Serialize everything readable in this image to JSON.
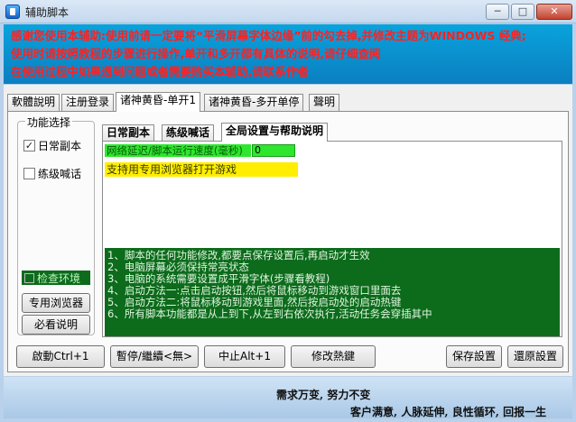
{
  "window": {
    "title": "辅助脚本",
    "min_label": "─",
    "max_label": "□",
    "close_label": "✕"
  },
  "banner": {
    "lines": [
      "感谢您使用本辅助:使用前请一定要将“平滑屏幕字体边缘”前的勾去掉,并修改主题为WINDOWS 经典;",
      "使用时请按照教程的步骤进行操作,单开和多开都有具体的说明,请仔细查阅",
      "在使用过程中如果遇到问题或者需要购买本辅助,请联系作者"
    ],
    "text_color": "#ff2020"
  },
  "tabs": [
    {
      "label": "軟體說明"
    },
    {
      "label": "注册登录"
    },
    {
      "label": "诸神黄昏-单开1"
    },
    {
      "label": "诸神黄昏-多开单停"
    },
    {
      "label": "聲明"
    }
  ],
  "function_group": {
    "legend": "功能选择",
    "daily_copy": {
      "label": "日常副本",
      "checked": true,
      "mark": "✓"
    },
    "practice_shout": {
      "label": "练级喊话",
      "checked": false,
      "mark": ""
    },
    "check_env": {
      "label": "检查环境",
      "checked": false,
      "mark": ""
    },
    "dedicated_browser_btn": "专用浏览器",
    "must_read_btn": "必看说明"
  },
  "inner_tabs": [
    {
      "label": "日常副本"
    },
    {
      "label": "练级喊话"
    },
    {
      "label": "全局设置与帮助说明"
    }
  ],
  "global_settings": {
    "network_delay_label": "网络延迟/脚本运行速度(毫秒)",
    "network_delay_value": "0",
    "dedicated_browser_text": "支持用专用浏览器打开游戏",
    "help_lines": [
      "1、脚本的任何功能修改,都要点保存设置后,再启动才生效",
      "2、电脑屏幕必须保持常亮状态",
      "3、电脑的系统需要设置成平滑字体(步骤看教程)",
      "4、启动方法一:点击启动按钮,然后将鼠标移动到游戏窗口里面去",
      "5、启动方法二:将鼠标移动到游戏里面,然后按启动处的启动热键",
      "6、所有脚本功能都是从上到下,从左到右依次执行,活动任务会穿插其中"
    ]
  },
  "buttons": {
    "start": "啟動Ctrl+1",
    "pause": "暫停/繼續<無>",
    "stop": "中止Alt+1",
    "modify_hotkey": "修改熱鍵",
    "save_settings": "保存設置",
    "restore_settings": "還原設置"
  },
  "footer": {
    "line1": "需求万变, 努力不变",
    "line2": "客户满意, 人脉延伸, 良性循环, 回报一生"
  }
}
